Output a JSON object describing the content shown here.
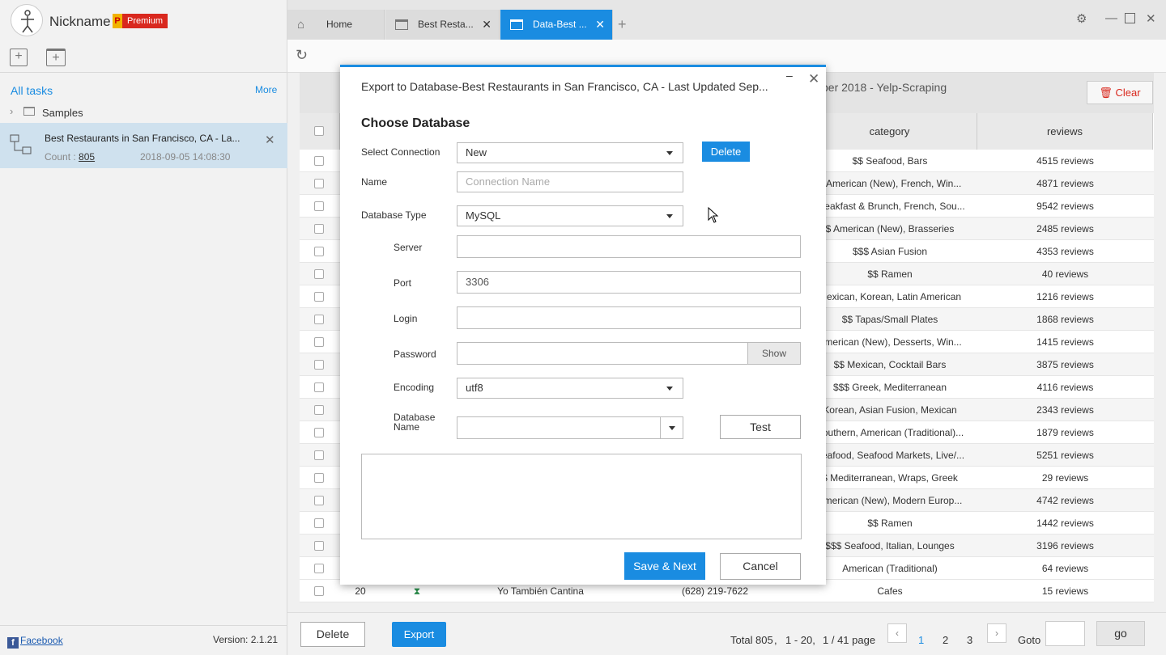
{
  "app": {
    "nickname": "Nickname",
    "premium_letter": "P",
    "premium_label": "Premium",
    "version": "Version: 2.1.21",
    "facebook": "Facebook"
  },
  "sidebar": {
    "all_tasks": "All tasks",
    "more": "More",
    "samples": "Samples",
    "task": {
      "title": "Best Restaurants in San Francisco, CA - La...",
      "count_label": "Count :",
      "count": "805",
      "date": "2018-09-05 14:08:30"
    }
  },
  "tabs": [
    {
      "label": "Home"
    },
    {
      "label": "Best Resta..."
    },
    {
      "label": "Data-Best ..."
    }
  ],
  "panel": {
    "title": "ber 2018 - Yelp-Scraping",
    "clear": "Clear"
  },
  "table": {
    "headers": {
      "category": "category",
      "reviews": "reviews"
    },
    "rows": [
      {
        "category": "$$ Seafood, Bars",
        "reviews": "4515 reviews"
      },
      {
        "category": "$ American (New), French, Win...",
        "reviews": "4871 reviews"
      },
      {
        "category": "Breakfast & Brunch, French, Sou...",
        "reviews": "9542 reviews"
      },
      {
        "category": "$ American (New), Brasseries",
        "reviews": "2485 reviews"
      },
      {
        "category": "$$$ Asian Fusion",
        "reviews": "4353 reviews"
      },
      {
        "category": "$$ Ramen",
        "reviews": "40 reviews"
      },
      {
        "category": "Mexican, Korean, Latin American",
        "reviews": "1216 reviews"
      },
      {
        "category": "$$ Tapas/Small Plates",
        "reviews": "1868 reviews"
      },
      {
        "category": "American (New), Desserts, Win...",
        "reviews": "1415 reviews"
      },
      {
        "category": "$$ Mexican, Cocktail Bars",
        "reviews": "3875 reviews"
      },
      {
        "category": "$$$ Greek, Mediterranean",
        "reviews": "4116 reviews"
      },
      {
        "category": "Korean, Asian Fusion, Mexican",
        "reviews": "2343 reviews"
      },
      {
        "category": "Southern, American (Traditional)...",
        "reviews": "1879 reviews"
      },
      {
        "category": "Seafood, Seafood Markets, Live/...",
        "reviews": "5251 reviews"
      },
      {
        "category": "$ Mediterranean, Wraps, Greek",
        "reviews": "29 reviews"
      },
      {
        "category": "American (New), Modern Europ...",
        "reviews": "4742 reviews"
      },
      {
        "category": "$$ Ramen",
        "reviews": "1442 reviews"
      },
      {
        "category": "$$$ Seafood, Italian, Lounges",
        "reviews": "3196 reviews"
      },
      {
        "category": "American (Traditional)",
        "reviews": "64 reviews"
      }
    ],
    "last_row": {
      "num": "20",
      "name": "Yo También Cantina",
      "phone": "(628) 219-7622",
      "category": "Cafes",
      "reviews": "15 reviews"
    }
  },
  "bottom": {
    "delete": "Delete",
    "export": "Export",
    "total_label": "Total",
    "total": "805",
    "range": "1 - 20,",
    "page_info": "1 / 41 page",
    "pages": [
      "1",
      "2",
      "3"
    ],
    "goto": "Goto",
    "go": "go"
  },
  "modal": {
    "title": "Export to Database-Best Restaurants in San Francisco, CA - Last Updated Sep...",
    "heading": "Choose Database",
    "select_connection_label": "Select Connection",
    "select_connection_value": "New",
    "delete": "Delete",
    "name_label": "Name",
    "name_placeholder": "Connection Name",
    "db_type_label": "Database Type",
    "db_type_value": "MySQL",
    "server_label": "Server",
    "port_label": "Port",
    "port_value": "3306",
    "login_label": "Login",
    "password_label": "Password",
    "show": "Show",
    "encoding_label": "Encoding",
    "encoding_value": "utf8",
    "dbname_label_1": "Database",
    "dbname_label_2": "Name",
    "test": "Test",
    "save_next": "Save & Next",
    "cancel": "Cancel"
  }
}
